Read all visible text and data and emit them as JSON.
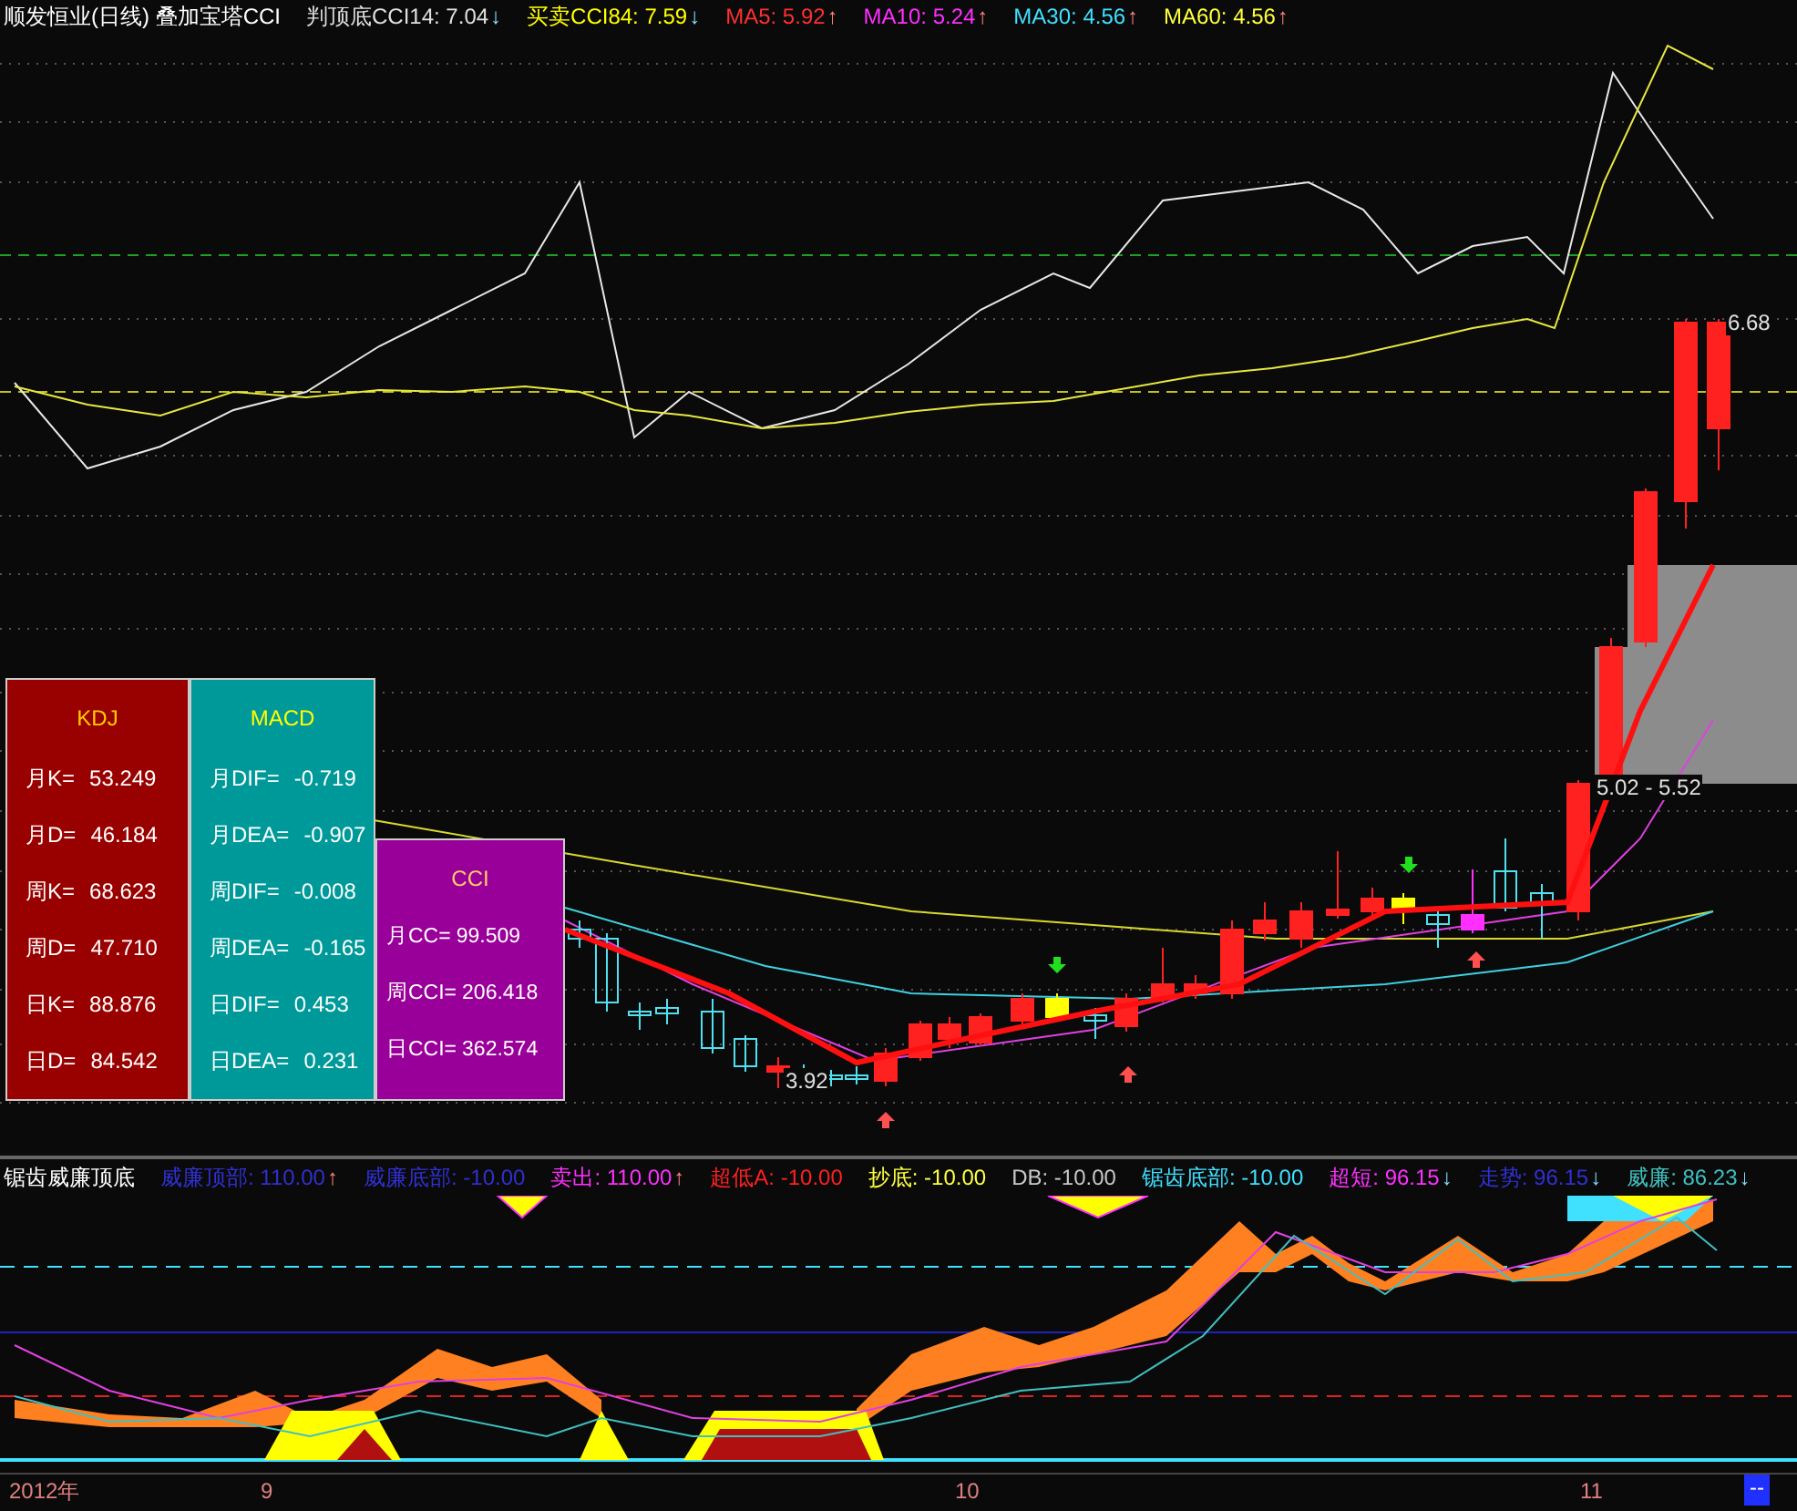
{
  "header": {
    "title": "顺发恒业(日线) 叠加宝塔CCI",
    "items": [
      {
        "label": "判顶底CCI14: 7.04",
        "arrow": "↓"
      },
      {
        "label": "买卖CCI84: 7.59",
        "arrow": "↓"
      },
      {
        "label": "MA5: 5.92",
        "arrow": "↑"
      },
      {
        "label": "MA10: 5.24",
        "arrow": "↑"
      },
      {
        "label": "MA30: 4.56",
        "arrow": "↑"
      },
      {
        "label": "MA60: 4.56",
        "arrow": "↑"
      }
    ]
  },
  "chart_labels": [
    {
      "text": "6.68"
    },
    {
      "text": "5.02 - 5.52"
    },
    {
      "text": "3.92"
    }
  ],
  "panels": [
    {
      "title": "KDJ",
      "color": "#990000",
      "rows": [
        {
          "label": "月K=",
          "value": "53.249"
        },
        {
          "label": "月D=",
          "value": "46.184"
        },
        {
          "label": "周K=",
          "value": "68.623"
        },
        {
          "label": "周D=",
          "value": "47.710"
        },
        {
          "label": "日K=",
          "value": "88.876"
        },
        {
          "label": "日D=",
          "value": "84.542"
        }
      ]
    },
    {
      "title": "MACD",
      "color": "#009999",
      "rows": [
        {
          "label": "月DIF=",
          "value": "-0.719"
        },
        {
          "label": "月DEA=",
          "value": "-0.907"
        },
        {
          "label": "周DIF=",
          "value": "-0.008"
        },
        {
          "label": "周DEA=",
          "value": "-0.165"
        },
        {
          "label": "日DIF=",
          "value": "0.453"
        },
        {
          "label": "日DEA=",
          "value": "0.231"
        }
      ]
    },
    {
      "title": "CCI",
      "color": "#990099",
      "rows": [
        {
          "label": "月CC=",
          "value": "99.509"
        },
        {
          "label": "周CCI=",
          "value": "206.418"
        },
        {
          "label": "日CCI=",
          "value": "362.574"
        }
      ]
    }
  ],
  "indicator": {
    "title": "锯齿威廉顶底",
    "items": [
      {
        "label": "威廉顶部: 110.00",
        "arrow": "↑"
      },
      {
        "label": "威廉底部: -10.00"
      },
      {
        "label": "卖出: 110.00",
        "arrow": "↑"
      },
      {
        "label": "超低A: -10.00"
      },
      {
        "label": "抄底: -10.00"
      },
      {
        "label": "DB: -10.00"
      },
      {
        "label": "锯齿底部: -10.00"
      },
      {
        "label": "超短: 96.15",
        "arrow": "↓"
      },
      {
        "label": "走势: 96.15",
        "arrow": "↓"
      },
      {
        "label": "威廉: 86.23",
        "arrow": "↓"
      }
    ]
  },
  "axis": {
    "labels": [
      "2012年",
      "9",
      "10",
      "11"
    ],
    "marker": "--"
  }
}
